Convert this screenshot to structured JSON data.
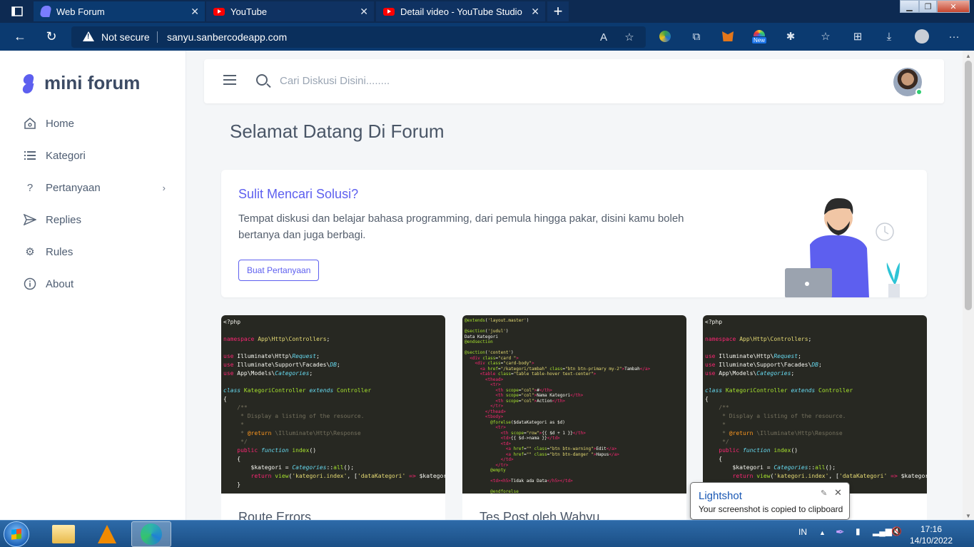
{
  "browser": {
    "tabs": [
      {
        "title": "Web Forum"
      },
      {
        "title": "YouTube"
      },
      {
        "title": "Detail video - YouTube Studio"
      }
    ],
    "security_label": "Not secure",
    "url": "sanyu.sanbercodeapp.com",
    "new_badge": "New"
  },
  "sidebar": {
    "brand": "mini forum",
    "items": [
      {
        "label": "Home"
      },
      {
        "label": "Kategori"
      },
      {
        "label": "Pertanyaan"
      },
      {
        "label": "Replies"
      },
      {
        "label": "Rules"
      },
      {
        "label": "About"
      }
    ]
  },
  "header": {
    "search_placeholder": "Cari Diskusi Disini........"
  },
  "main": {
    "title": "Selamat Datang Di Forum",
    "welcome": {
      "heading": "Sulit Mencari Solusi?",
      "body": "Tempat diskusi dan belajar bahasa programming, dari pemula hingga pakar, disini kamu boleh bertanya dan juga berbagi.",
      "button": "Buat Pertanyaan"
    },
    "posts": [
      {
        "title": "Route Errors"
      },
      {
        "title": "Tes Post oleh Wahyu"
      }
    ]
  },
  "lightshot": {
    "title": "Lightshot",
    "message": "Your screenshot is copied to clipboard"
  },
  "taskbar": {
    "lang": "IN",
    "time": "17:16",
    "date": "14/10/2022"
  },
  "colors": {
    "accent": "#5d5fef",
    "browser_tabbar": "#0d2a52",
    "browser_addressbar": "#0b3a70"
  }
}
